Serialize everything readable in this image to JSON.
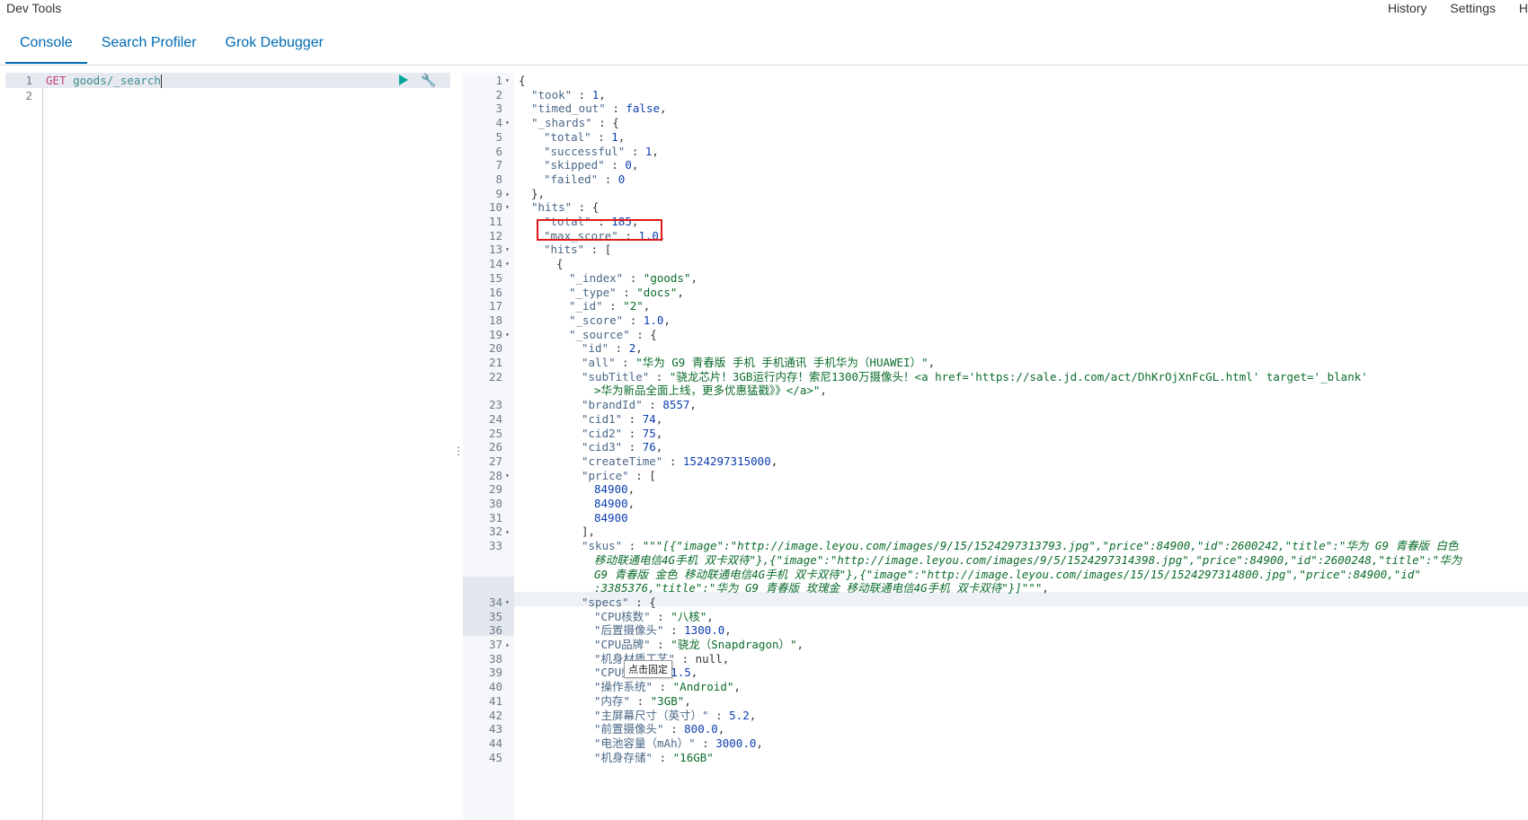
{
  "app": {
    "title": "Dev Tools"
  },
  "top_links": [
    "History",
    "Settings",
    "H"
  ],
  "tabs": [
    {
      "label": "Console",
      "active": true
    },
    {
      "label": "Search Profiler",
      "active": false
    },
    {
      "label": "Grok Debugger",
      "active": false
    }
  ],
  "request": {
    "lines": [
      {
        "num": "1",
        "method": "GET",
        "path": "goods/_search"
      },
      {
        "num": "2",
        "method": "",
        "path": ""
      }
    ]
  },
  "response": {
    "lines": [
      {
        "n": "1",
        "f": "▾",
        "i": 0,
        "t": [
          [
            "p",
            "{"
          ]
        ]
      },
      {
        "n": "2",
        "f": "",
        "i": 1,
        "t": [
          [
            "k",
            "\"took\""
          ],
          [
            "p",
            " : "
          ],
          [
            "n",
            "1"
          ],
          [
            "p",
            ","
          ]
        ]
      },
      {
        "n": "3",
        "f": "",
        "i": 1,
        "t": [
          [
            "k",
            "\"timed_out\""
          ],
          [
            "p",
            " : "
          ],
          [
            "n",
            "false"
          ],
          [
            "p",
            ","
          ]
        ]
      },
      {
        "n": "4",
        "f": "▾",
        "i": 1,
        "t": [
          [
            "k",
            "\"_shards\""
          ],
          [
            "p",
            " : {"
          ]
        ]
      },
      {
        "n": "5",
        "f": "",
        "i": 2,
        "t": [
          [
            "k",
            "\"total\""
          ],
          [
            "p",
            " : "
          ],
          [
            "n",
            "1"
          ],
          [
            "p",
            ","
          ]
        ]
      },
      {
        "n": "6",
        "f": "",
        "i": 2,
        "t": [
          [
            "k",
            "\"successful\""
          ],
          [
            "p",
            " : "
          ],
          [
            "n",
            "1"
          ],
          [
            "p",
            ","
          ]
        ]
      },
      {
        "n": "7",
        "f": "",
        "i": 2,
        "t": [
          [
            "k",
            "\"skipped\""
          ],
          [
            "p",
            " : "
          ],
          [
            "n",
            "0"
          ],
          [
            "p",
            ","
          ]
        ]
      },
      {
        "n": "8",
        "f": "",
        "i": 2,
        "t": [
          [
            "k",
            "\"failed\""
          ],
          [
            "p",
            " : "
          ],
          [
            "n",
            "0"
          ]
        ]
      },
      {
        "n": "9",
        "f": "▴",
        "i": 1,
        "t": [
          [
            "p",
            "},"
          ]
        ]
      },
      {
        "n": "10",
        "f": "▾",
        "i": 1,
        "t": [
          [
            "k",
            "\"hits\""
          ],
          [
            "p",
            " : {"
          ]
        ]
      },
      {
        "n": "11",
        "f": "",
        "i": 2,
        "t": [
          [
            "k",
            "\"total\""
          ],
          [
            "p",
            " : "
          ],
          [
            "n",
            "185"
          ],
          [
            "p",
            ","
          ]
        ]
      },
      {
        "n": "12",
        "f": "",
        "i": 2,
        "t": [
          [
            "k",
            "\"max_score\""
          ],
          [
            "p",
            " : "
          ],
          [
            "n",
            "1.0"
          ],
          [
            "p",
            ","
          ]
        ]
      },
      {
        "n": "13",
        "f": "▾",
        "i": 2,
        "t": [
          [
            "k",
            "\"hits\""
          ],
          [
            "p",
            " : ["
          ]
        ]
      },
      {
        "n": "14",
        "f": "▾",
        "i": 3,
        "t": [
          [
            "p",
            "{"
          ]
        ]
      },
      {
        "n": "15",
        "f": "",
        "i": 4,
        "t": [
          [
            "k",
            "\"_index\""
          ],
          [
            "p",
            " : "
          ],
          [
            "s",
            "\"goods\""
          ],
          [
            "p",
            ","
          ]
        ]
      },
      {
        "n": "16",
        "f": "",
        "i": 4,
        "t": [
          [
            "k",
            "\"_type\""
          ],
          [
            "p",
            " : "
          ],
          [
            "s",
            "\"docs\""
          ],
          [
            "p",
            ","
          ]
        ]
      },
      {
        "n": "17",
        "f": "",
        "i": 4,
        "t": [
          [
            "k",
            "\"_id\""
          ],
          [
            "p",
            " : "
          ],
          [
            "s",
            "\"2\""
          ],
          [
            "p",
            ","
          ]
        ]
      },
      {
        "n": "18",
        "f": "",
        "i": 4,
        "t": [
          [
            "k",
            "\"_score\""
          ],
          [
            "p",
            " : "
          ],
          [
            "n",
            "1.0"
          ],
          [
            "p",
            ","
          ]
        ]
      },
      {
        "n": "19",
        "f": "▾",
        "i": 4,
        "t": [
          [
            "k",
            "\"_source\""
          ],
          [
            "p",
            " : {"
          ]
        ]
      },
      {
        "n": "20",
        "f": "",
        "i": 5,
        "t": [
          [
            "k",
            "\"id\""
          ],
          [
            "p",
            " : "
          ],
          [
            "n",
            "2"
          ],
          [
            "p",
            ","
          ]
        ]
      },
      {
        "n": "21",
        "f": "",
        "i": 5,
        "t": [
          [
            "k",
            "\"all\""
          ],
          [
            "p",
            " : "
          ],
          [
            "s",
            "\"华为 G9 青春版 手机 手机通讯 手机华为（HUAWEI）\""
          ],
          [
            "p",
            ","
          ]
        ]
      },
      {
        "n": "22",
        "f": "",
        "i": 5,
        "t": [
          [
            "k",
            "\"subTitle\""
          ],
          [
            "p",
            " : "
          ],
          [
            "s",
            "\"骁龙芯片！3GB运行内存！索尼1300万摄像头！<a href='https://sale.jd.com/act/DhKrOjXnFcGL.html' target='_blank'"
          ]
        ]
      },
      {
        "n": "",
        "f": "",
        "i": 6,
        "t": [
          [
            "s",
            ">华为新品全面上线，更多优惠猛戳》》</a>\""
          ],
          [
            "p",
            ","
          ]
        ]
      },
      {
        "n": "23",
        "f": "",
        "i": 5,
        "t": [
          [
            "k",
            "\"brandId\""
          ],
          [
            "p",
            " : "
          ],
          [
            "n",
            "8557"
          ],
          [
            "p",
            ","
          ]
        ]
      },
      {
        "n": "24",
        "f": "",
        "i": 5,
        "t": [
          [
            "k",
            "\"cid1\""
          ],
          [
            "p",
            " : "
          ],
          [
            "n",
            "74"
          ],
          [
            "p",
            ","
          ]
        ]
      },
      {
        "n": "25",
        "f": "",
        "i": 5,
        "t": [
          [
            "k",
            "\"cid2\""
          ],
          [
            "p",
            " : "
          ],
          [
            "n",
            "75"
          ],
          [
            "p",
            ","
          ]
        ]
      },
      {
        "n": "26",
        "f": "",
        "i": 5,
        "t": [
          [
            "k",
            "\"cid3\""
          ],
          [
            "p",
            " : "
          ],
          [
            "n",
            "76"
          ],
          [
            "p",
            ","
          ]
        ]
      },
      {
        "n": "27",
        "f": "",
        "i": 5,
        "t": [
          [
            "k",
            "\"createTime\""
          ],
          [
            "p",
            " : "
          ],
          [
            "n",
            "1524297315000"
          ],
          [
            "p",
            ","
          ]
        ]
      },
      {
        "n": "28",
        "f": "▾",
        "i": 5,
        "t": [
          [
            "k",
            "\"price\""
          ],
          [
            "p",
            " : ["
          ]
        ]
      },
      {
        "n": "29",
        "f": "",
        "i": 6,
        "t": [
          [
            "n",
            "84900"
          ],
          [
            "p",
            ","
          ]
        ]
      },
      {
        "n": "30",
        "f": "",
        "i": 6,
        "t": [
          [
            "n",
            "84900"
          ],
          [
            "p",
            ","
          ]
        ]
      },
      {
        "n": "31",
        "f": "",
        "i": 6,
        "t": [
          [
            "n",
            "84900"
          ]
        ]
      },
      {
        "n": "32",
        "f": "▴",
        "i": 5,
        "t": [
          [
            "p",
            "],"
          ]
        ]
      },
      {
        "n": "33",
        "f": "",
        "i": 5,
        "t": [
          [
            "k",
            "\"skus\""
          ],
          [
            "p",
            " : "
          ],
          [
            "it",
            "\"\"\"[{\"image\":\"http://image.leyou.com/images/9/15/1524297313793.jpg\",\"price\":84900,\"id\":2600242,\"title\":\"华为 G9 青春版 白色"
          ]
        ]
      },
      {
        "n": "",
        "f": "",
        "i": 6,
        "t": [
          [
            "it",
            "移动联通电信4G手机 双卡双待\"},{\"image\":\"http://image.leyou.com/images/9/5/1524297314398.jpg\",\"price\":84900,\"id\":2600248,\"title\":\"华为"
          ]
        ]
      },
      {
        "n": "",
        "f": "",
        "i": 6,
        "t": [
          [
            "it",
            "G9 青春版 金色 移动联通电信4G手机 双卡双待\"},{\"image\":\"http://image.leyou.com/images/15/15/1524297314800.jpg\",\"price\":84900,\"id\""
          ]
        ]
      },
      {
        "n": "",
        "f": "",
        "i": 6,
        "t": [
          [
            "it",
            ":3385376,\"title\":\"华为 G9 青春版 玫瑰金 移动联通电信4G手机 双卡双待\"}]\"\"\""
          ],
          [
            "p",
            ","
          ]
        ]
      },
      {
        "n": "34",
        "f": "▾",
        "i": 5,
        "t": [
          [
            "k",
            "\"specs\""
          ],
          [
            "p",
            " : {"
          ]
        ]
      },
      {
        "n": "35",
        "f": "",
        "i": 6,
        "t": [
          [
            "k",
            "\"CPU核数\""
          ],
          [
            "p",
            " : "
          ],
          [
            "s",
            "\"八核\""
          ],
          [
            "p",
            ","
          ]
        ]
      },
      {
        "n": "36",
        "f": "",
        "i": 6,
        "t": [
          [
            "k",
            "\"后置摄像头\""
          ],
          [
            "p",
            " : "
          ],
          [
            "n",
            "1300.0"
          ],
          [
            "p",
            ","
          ]
        ]
      },
      {
        "n": "37",
        "f": "▴",
        "i": 6,
        "t": [
          [
            "k",
            "\"CPU品牌\""
          ],
          [
            "p",
            " : "
          ],
          [
            "s",
            "\"骁龙（Snapdragon）\""
          ],
          [
            "p",
            ","
          ]
        ]
      },
      {
        "n": "38",
        "f": "",
        "i": 6,
        "t": [
          [
            "k",
            "\"机身材质工艺\""
          ],
          [
            "p",
            " : "
          ],
          [
            "p",
            "null,"
          ]
        ]
      },
      {
        "n": "39",
        "f": "",
        "i": 6,
        "t": [
          [
            "k",
            "\"CPU频率\""
          ],
          [
            "p",
            " : "
          ],
          [
            "n",
            "1.5"
          ],
          [
            "p",
            ","
          ]
        ]
      },
      {
        "n": "40",
        "f": "",
        "i": 6,
        "t": [
          [
            "k",
            "\"操作系统\""
          ],
          [
            "p",
            " : "
          ],
          [
            "s",
            "\"Android\""
          ],
          [
            "p",
            ","
          ]
        ]
      },
      {
        "n": "41",
        "f": "",
        "i": 6,
        "t": [
          [
            "k",
            "\"内存\""
          ],
          [
            "p",
            " : "
          ],
          [
            "s",
            "\"3GB\""
          ],
          [
            "p",
            ","
          ]
        ]
      },
      {
        "n": "42",
        "f": "",
        "i": 6,
        "t": [
          [
            "k",
            "\"主屏幕尺寸（英寸）\""
          ],
          [
            "p",
            " : "
          ],
          [
            "n",
            "5.2"
          ],
          [
            "p",
            ","
          ]
        ]
      },
      {
        "n": "43",
        "f": "",
        "i": 6,
        "t": [
          [
            "k",
            "\"前置摄像头\""
          ],
          [
            "p",
            " : "
          ],
          [
            "n",
            "800.0"
          ],
          [
            "p",
            ","
          ]
        ]
      },
      {
        "n": "44",
        "f": "",
        "i": 6,
        "t": [
          [
            "k",
            "\"电池容量（mAh）\""
          ],
          [
            "p",
            " : "
          ],
          [
            "n",
            "3000.0"
          ],
          [
            "p",
            ","
          ]
        ]
      },
      {
        "n": "45",
        "f": "",
        "i": 6,
        "t": [
          [
            "k",
            "\"机身存储\""
          ],
          [
            "p",
            " : "
          ],
          [
            "s",
            "\"16GB\""
          ]
        ]
      }
    ]
  },
  "tooltip": {
    "text": "点击固定"
  }
}
